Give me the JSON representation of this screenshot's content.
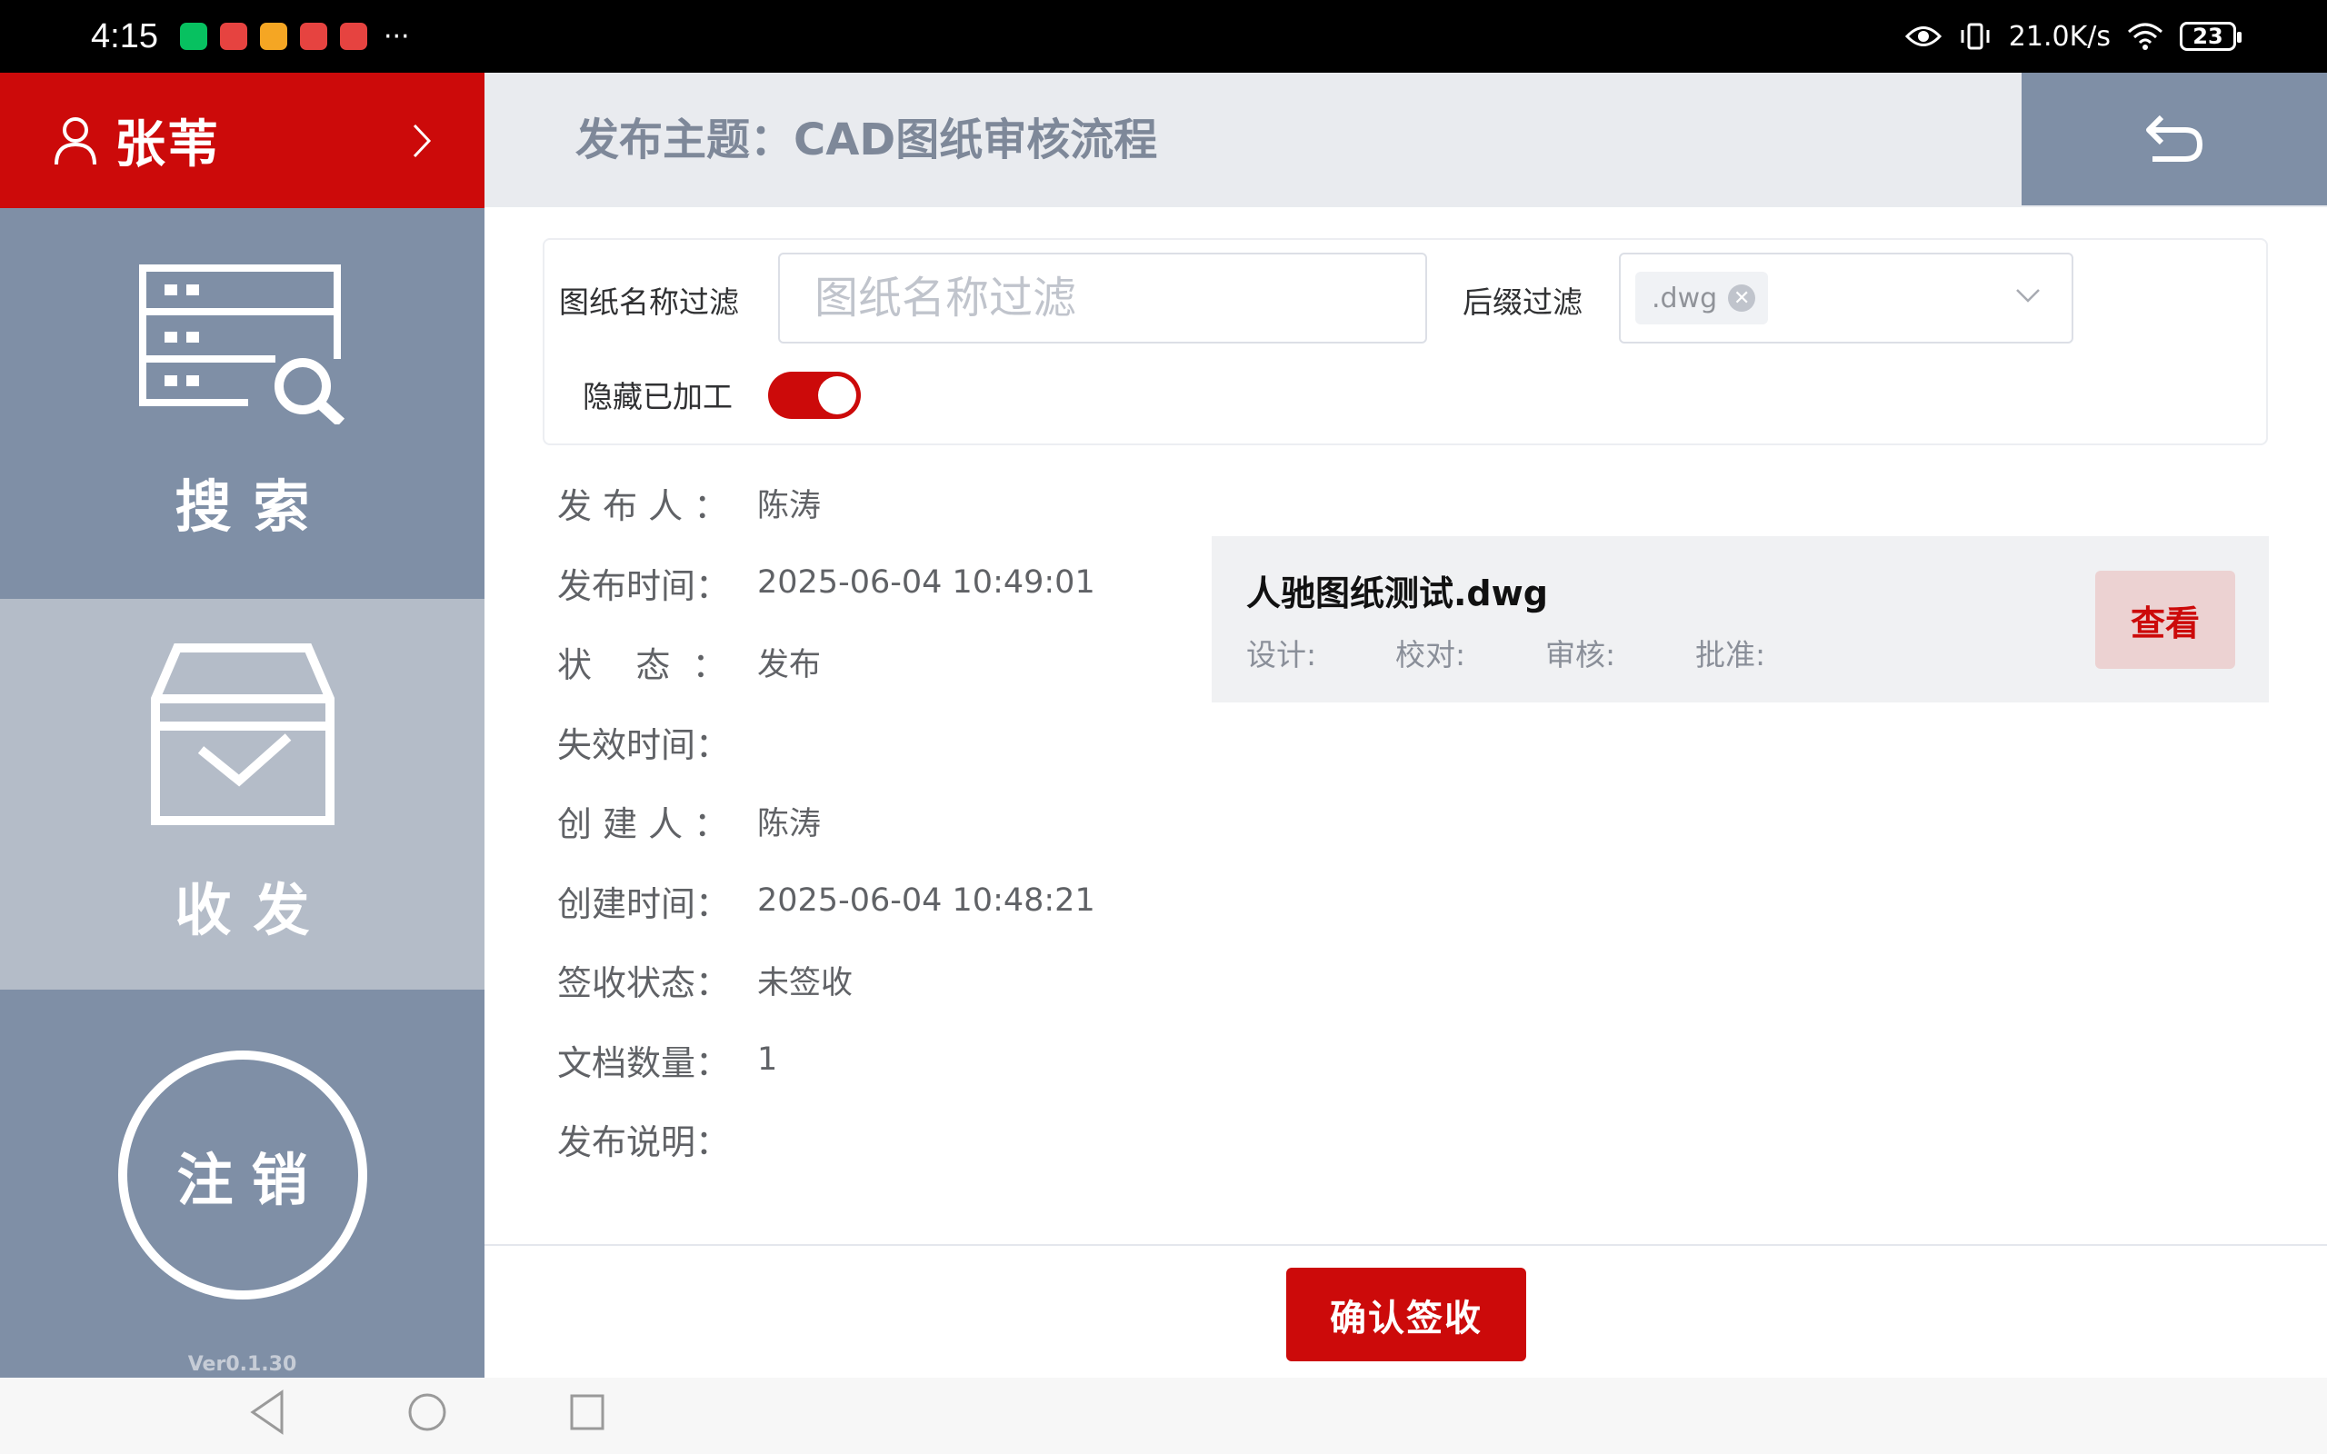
{
  "status_bar": {
    "time": "4:15",
    "more": "···",
    "net_speed": "21.0K/s",
    "battery": "23",
    "notification_icons": [
      "wechat-icon",
      "red-app-icon",
      "orange-app-icon",
      "red-app-icon-2",
      "red-app-icon-3"
    ],
    "app_colors": [
      "#07c160",
      "#e64340",
      "#f5a623",
      "#e64340",
      "#e64340"
    ]
  },
  "sidebar": {
    "user_name": "张苇",
    "nav": [
      {
        "label": "搜索",
        "icon": "search-list-icon",
        "active": false
      },
      {
        "label": "收发",
        "icon": "inbox-check-icon",
        "active": true
      }
    ],
    "logout_label": "注销",
    "version": "Ver0.1.30"
  },
  "header": {
    "title": "发布主题：CAD图纸审核流程",
    "back_icon": "undo-arrow-icon"
  },
  "filters": {
    "name_label": "图纸名称过滤",
    "name_value": "",
    "name_placeholder": "图纸名称过滤",
    "suffix_label": "后缀过滤",
    "suffix_tag": ".dwg",
    "hide_label": "隐藏已加工",
    "hide_on": true
  },
  "info": [
    {
      "key": "发 布 人 ：",
      "value": "陈涛"
    },
    {
      "key": "发布时间：",
      "value": "2025-06-04 10:49:01"
    },
    {
      "key": "状    态  ：",
      "value": "发布"
    },
    {
      "key": "失效时间：",
      "value": ""
    },
    {
      "key": "创 建 人 ：",
      "value": "陈涛"
    },
    {
      "key": "创建时间：",
      "value": "2025-06-04 10:48:21"
    },
    {
      "key": "签收状态：",
      "value": "未签收"
    },
    {
      "key": "文档数量：",
      "value": "1"
    },
    {
      "key": "发布说明：",
      "value": ""
    }
  ],
  "document": {
    "name": "人驰图纸测试.dwg",
    "design_label": "设计:",
    "check_label": "校对:",
    "review_label": "审核:",
    "approve_label": "批准:",
    "view_button": "查看"
  },
  "actions": {
    "confirm_button": "确认签收"
  },
  "colors": {
    "brand_red": "#cc0a0a",
    "sidebar_gray": "#7f8fa6",
    "sidebar_active": "#b4bcc8"
  }
}
